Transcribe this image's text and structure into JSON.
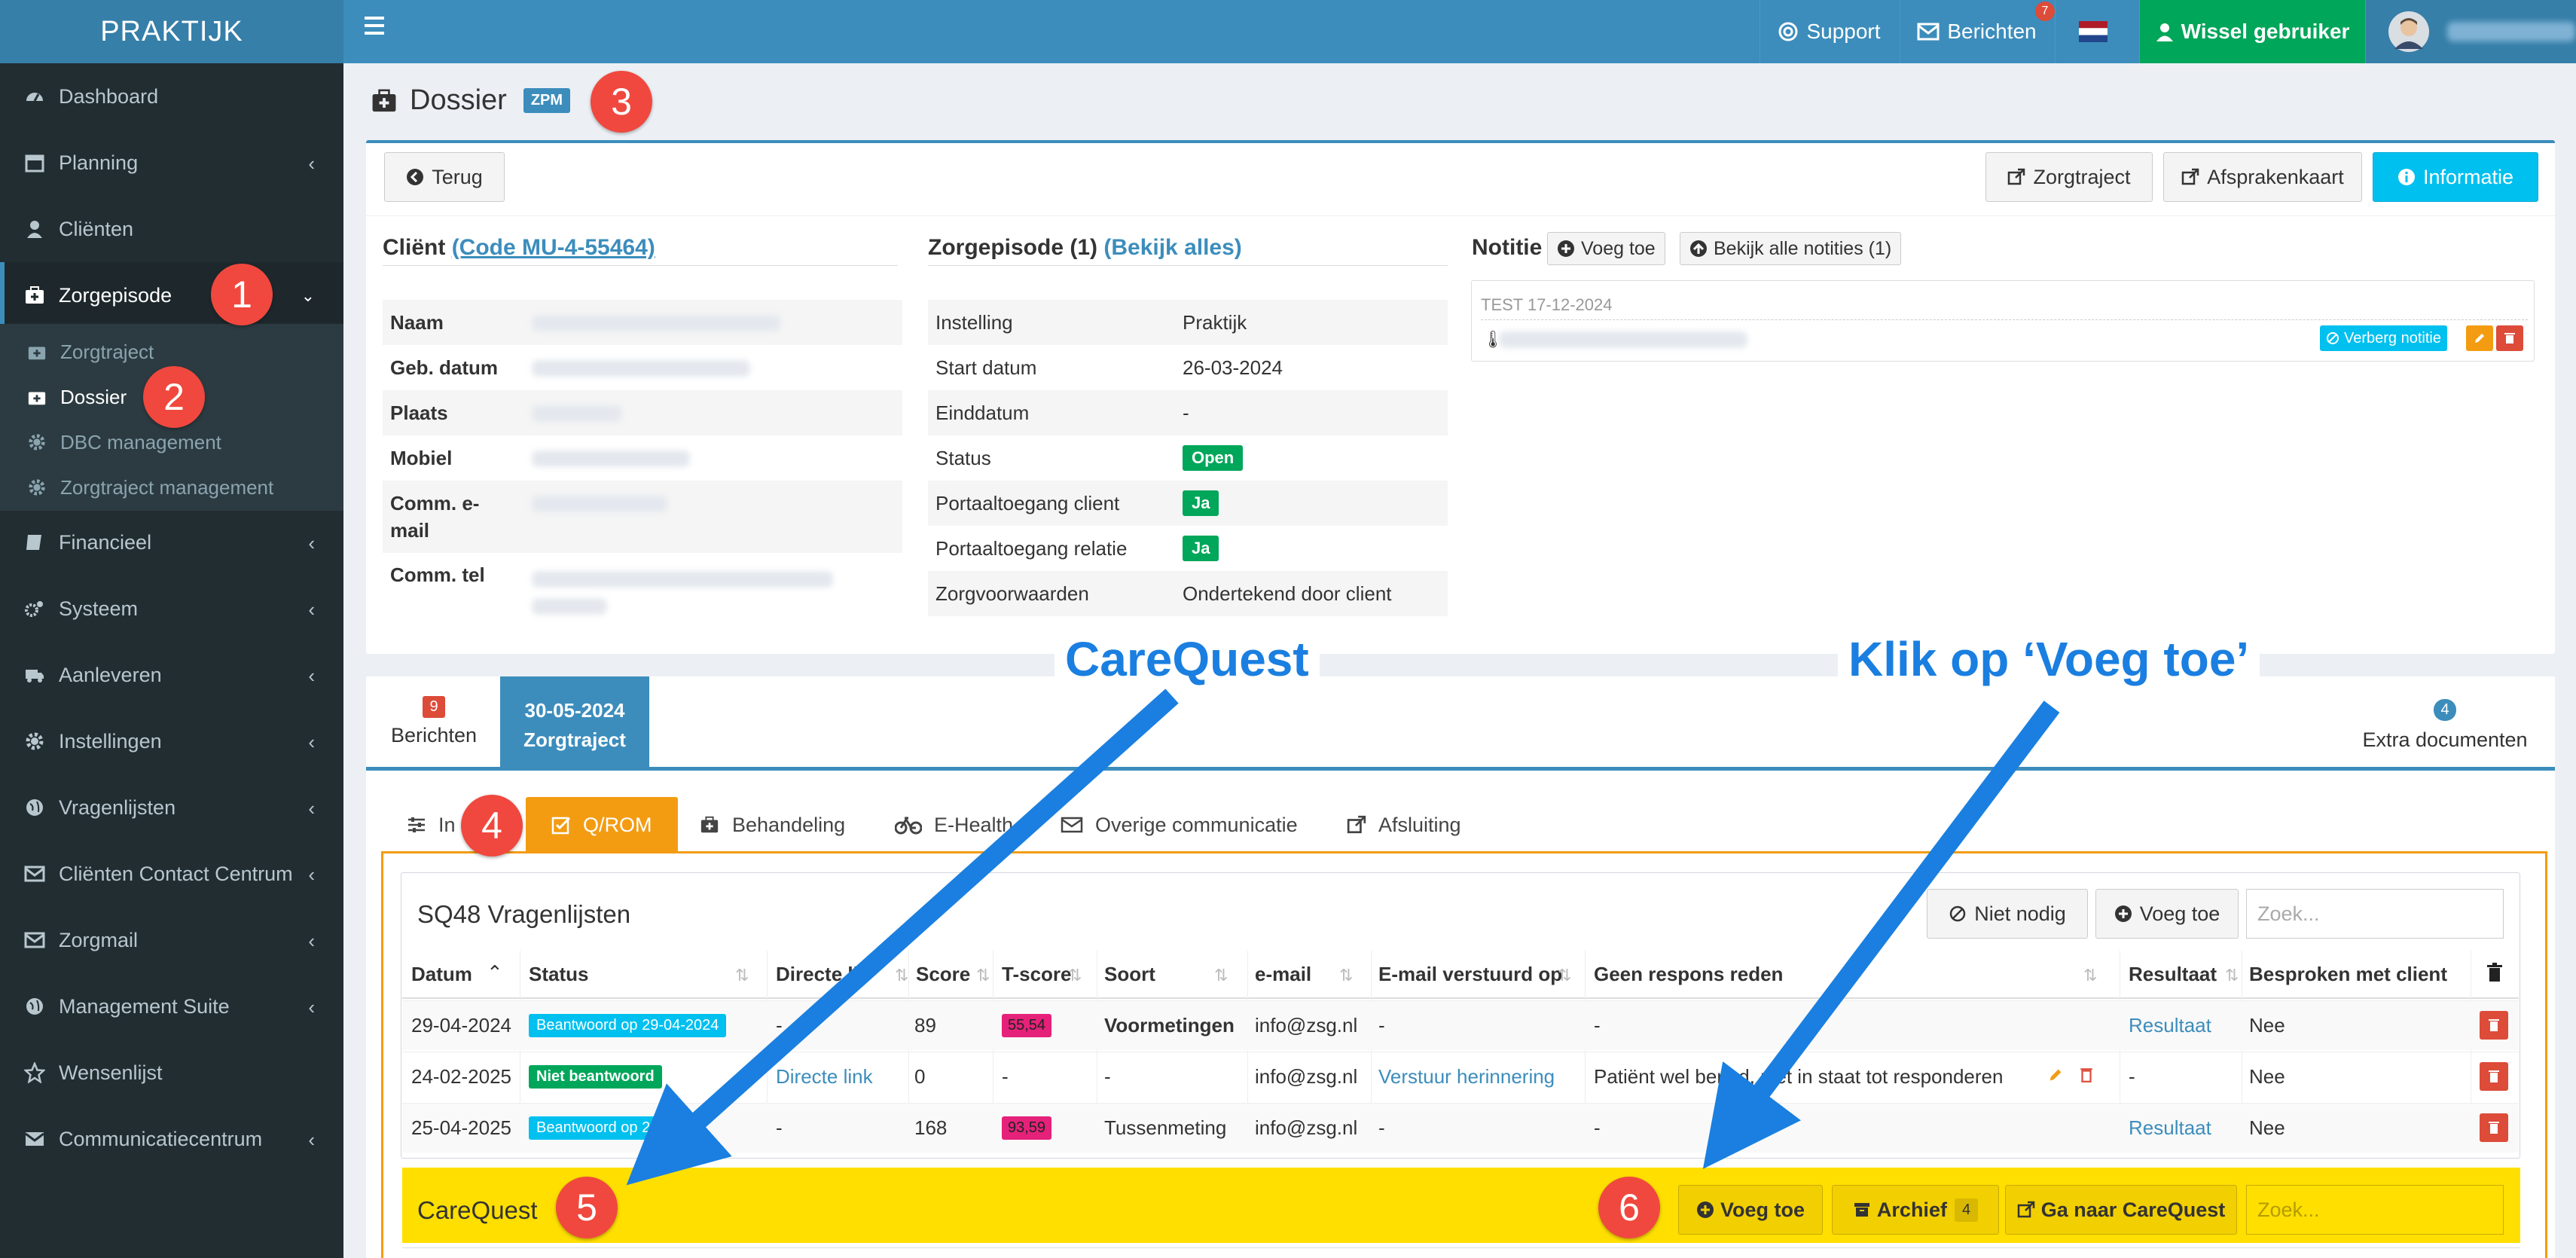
{
  "topbar": {
    "logo": "PRAKTIJK",
    "support": "Support",
    "berichten": "Berichten",
    "berichten_count": "7",
    "wissel": "Wissel gebruiker"
  },
  "sidebar": {
    "items": [
      {
        "label": "Dashboard"
      },
      {
        "label": "Planning"
      },
      {
        "label": "Cliënten"
      },
      {
        "label": "Zorgepisode"
      },
      {
        "label": "Financieel"
      },
      {
        "label": "Systeem"
      },
      {
        "label": "Aanleveren"
      },
      {
        "label": "Instellingen"
      },
      {
        "label": "Vragenlijsten"
      },
      {
        "label": "Cliënten Contact Centrum"
      },
      {
        "label": "Zorgmail"
      },
      {
        "label": "Management Suite"
      },
      {
        "label": "Wensenlijst"
      },
      {
        "label": "Communicatiecentrum"
      }
    ],
    "sub": [
      {
        "label": "Zorgtraject"
      },
      {
        "label": "Dossier"
      },
      {
        "label": "DBC management"
      },
      {
        "label": "Zorgtraject management"
      }
    ]
  },
  "steps": [
    "1",
    "2",
    "3",
    "4",
    "5",
    "6"
  ],
  "page": {
    "title": "Dossier",
    "badge": "ZPM",
    "terug": "Terug",
    "zorgtraject_btn": "Zorgtraject",
    "afsprakenkaart_btn": "Afsprakenkaart",
    "informatie_btn": "Informatie"
  },
  "client": {
    "heading": "Cliënt",
    "code_link": "(Code MU-4-55464)",
    "rows": [
      {
        "key": "Naam"
      },
      {
        "key": "Geb. datum"
      },
      {
        "key": "Plaats"
      },
      {
        "key": "Mobiel"
      },
      {
        "key": "Comm. e-mail"
      },
      {
        "key": "Comm. tel"
      }
    ]
  },
  "zorgepisode": {
    "heading": "Zorgepisode (1)",
    "link": "(Bekijk alles)",
    "rows": [
      {
        "key": "Instelling",
        "value": "Praktijk"
      },
      {
        "key": "Start datum",
        "value": "26-03-2024"
      },
      {
        "key": "Einddatum",
        "value": "-"
      },
      {
        "key": "Status",
        "value": "Open"
      },
      {
        "key": "Portaaltoegang client",
        "value": "Ja"
      },
      {
        "key": "Portaaltoegang relatie",
        "value": "Ja"
      },
      {
        "key": "Zorgvoorwaarden",
        "value": "Ondertekend door client"
      }
    ]
  },
  "notitie": {
    "heading": "Notitie",
    "voeg_toe": "Voeg toe",
    "bekijk_alle": "Bekijk alle notities (1)",
    "note_date": "TEST 17-12-2024",
    "verberg": "Verberg notitie"
  },
  "tabs": {
    "berichten_count": "9",
    "berichten": "Berichten",
    "zorg_date": "30-05-2024",
    "zorg_label": "Zorgtraject",
    "extra_count": "4",
    "extra": "Extra documenten"
  },
  "subtabs": [
    "In",
    "Q/ROM",
    "Behandeling",
    "E-Health",
    "Overige communicatie",
    "Afsluiting"
  ],
  "sq48": {
    "title": "SQ48 Vragenlijsten",
    "niet_nodig": "Niet nodig",
    "voeg_toe": "Voeg toe",
    "search_placeholder": "Zoek...",
    "columns": [
      "Datum",
      "Status",
      "Directe li",
      "Score",
      "T-score",
      "Soort",
      "e-mail",
      "E-mail verstuurd op",
      "Geen respons reden",
      "Resultaat",
      "Besproken met client"
    ],
    "rows": [
      {
        "datum": "29-04-2024",
        "status": "Beantwoord op 29-04-2024",
        "directe": "-",
        "score": "89",
        "tscore": "55,54",
        "soort": "Voormetingen",
        "email": "info@zsg.nl",
        "verstuurd": "-",
        "reden": "-",
        "resultaat": "Resultaat",
        "besproken": "Nee"
      },
      {
        "datum": "24-02-2025",
        "status": "Niet beantwoord",
        "directe": "Directe link",
        "score": "0",
        "tscore": "-",
        "soort": "-",
        "email": "info@zsg.nl",
        "verstuurd": "Verstuur herinnering",
        "reden": "Patiënt wel benad, niet in staat tot responderen",
        "resultaat": "-",
        "besproken": "Nee"
      },
      {
        "datum": "25-04-2025",
        "status": "Beantwoord op 2025",
        "directe": "-",
        "score": "168",
        "tscore": "93,59",
        "soort": "Tussenmeting",
        "email": "info@zsg.nl",
        "verstuurd": "-",
        "reden": "-",
        "resultaat": "Resultaat",
        "besproken": "Nee"
      }
    ]
  },
  "carequest": {
    "title": "CareQuest",
    "voeg_toe": "Voeg toe",
    "archief": "Archief",
    "archief_count": "4",
    "ga_naar": "Ga naar CareQuest",
    "search_placeholder": "Zoek..."
  },
  "annotations": {
    "carequest": "CareQuest",
    "klik": "Klik op ‘Voeg toe’"
  },
  "colors": {
    "primary": "#3c8dbc",
    "sidebar": "#222d32",
    "green": "#00a65a",
    "orange": "#f39c12",
    "yellow": "#ffdf00",
    "red": "#dd4b39",
    "info": "#00c0ef",
    "arrow": "#1a7fe0",
    "step": "#f0483e"
  }
}
